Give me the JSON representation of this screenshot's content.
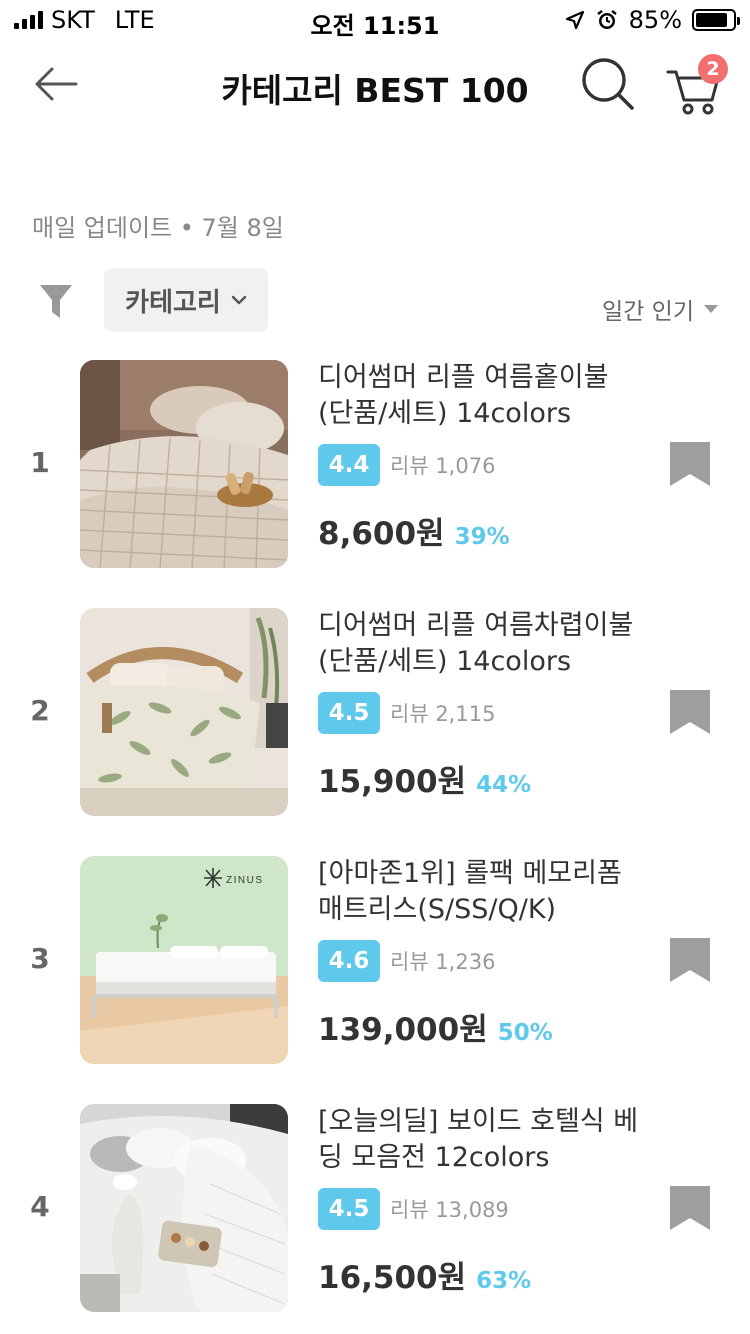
{
  "status_bar": {
    "carrier": "SKT",
    "network": "LTE",
    "time": "오전 11:51",
    "battery": "85%",
    "battery_level": 0.85
  },
  "header": {
    "title": "카테고리 BEST 100",
    "cart_count": "2"
  },
  "update_info": "매일 업데이트 • 7월 8일",
  "filter": {
    "category_label": "카테고리",
    "sort_label": "일간 인기"
  },
  "products": [
    {
      "rank": "1",
      "name": "디어썸머 리플 여름홑이불 (단품/세트) 14colors",
      "rating": "4.4",
      "reviews": "리뷰 1,076",
      "price": "8,600원",
      "discount": "39%"
    },
    {
      "rank": "2",
      "name": "디어썸머 리플 여름차렵이불(단품/세트) 14colors",
      "rating": "4.5",
      "reviews": "리뷰 2,115",
      "price": "15,900원",
      "discount": "44%"
    },
    {
      "rank": "3",
      "name": "[아마존1위] 롤팩 메모리폼 매트리스(S/SS/Q/K)",
      "rating": "4.6",
      "reviews": "리뷰 1,236",
      "price": "139,000원",
      "discount": "50%"
    },
    {
      "rank": "4",
      "name": "[오늘의딜] 보이드 호텔식 베딩 모음전 12colors",
      "rating": "4.5",
      "reviews": "리뷰 13,089",
      "price": "16,500원",
      "discount": "63%"
    }
  ],
  "image_text": {
    "zinus_logo": "ZINUS"
  },
  "colors": {
    "accent": "#5fc9ec",
    "badge": "#f36e6e"
  },
  "icons": [
    "back-arrow-icon",
    "search-icon",
    "cart-icon",
    "filter-icon",
    "chevron-down-icon",
    "bookmark-icon"
  ]
}
